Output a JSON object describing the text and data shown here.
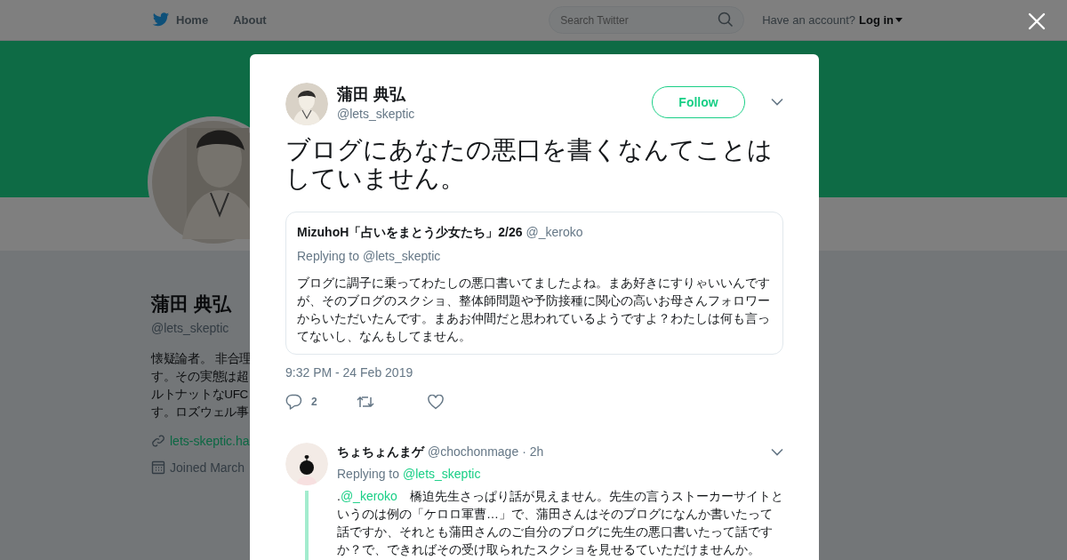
{
  "top_nav": {
    "links": [
      {
        "label": "Home",
        "kind": "home"
      },
      {
        "label": "About",
        "kind": "plain"
      }
    ],
    "search": {
      "placeholder": "Search Twitter"
    },
    "account_prompt": "Have an account?",
    "login": "Log in"
  },
  "profile": {
    "name": "蒲田 典弘",
    "handle": "@lets_skeptic",
    "bio_lines": [
      "懐疑論者。 非合理",
      "す。その実態は超",
      "ルトナットなUFC",
      "す。ロズウェル事"
    ],
    "website": "lets-skeptic.ha",
    "joined": "Joined March"
  },
  "tweet": {
    "name": "蒲田 典弘",
    "handle": "@lets_skeptic",
    "follow": "Follow",
    "text": "ブログにあなたの悪口を書くなんてことはしていません。",
    "quote": {
      "name": "MizuhoH「占いをまとう少女たち」2/26",
      "handle": "@_keroko",
      "replying": "Replying to @lets_skeptic",
      "text": "ブログに調子に乗ってわたしの悪口書いてましたよね。まあ好きにすりゃいいんですが、そのブログのスクショ、整体師問題や予防接種に関心の高いお母さんフォロワーからいただいたんです。まあお仲間だと思われているようですよ？わたしは何も言ってないし、なんもしてません。"
    },
    "time": "9:32 PM - 24 Feb 2019",
    "reply_count": "2"
  },
  "replies": [
    {
      "name": "ちょちょんまゲ",
      "handle": "@chochonmage",
      "time": "· 2h",
      "replying_prefix": "Replying to",
      "replying_to": "@lets_skeptic",
      "prefix": ".",
      "mention": "@_keroko",
      "text": "　橋迫先生さっぱり話が見えません。先生の言うストーカーサイトというのは例の「ケロロ軍曹…」で、蒲田さんはそのブログになんか書いたって話ですか、それとも蒲田さんのご自分のブログに先生の悪口書いたって話ですか？で、できればその受け取られたスクショを見せるていただけませんか。"
    }
  ]
}
